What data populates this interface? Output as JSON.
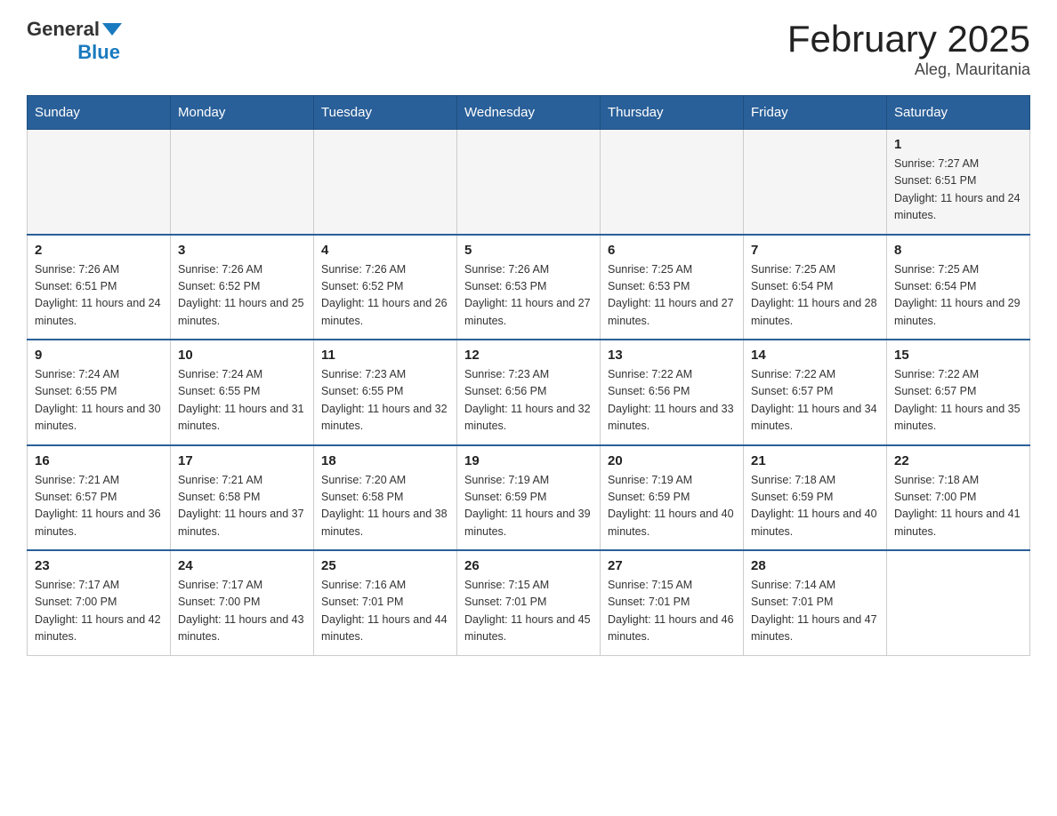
{
  "header": {
    "logo_general": "General",
    "logo_blue": "Blue",
    "title": "February 2025",
    "location": "Aleg, Mauritania"
  },
  "days_of_week": [
    "Sunday",
    "Monday",
    "Tuesday",
    "Wednesday",
    "Thursday",
    "Friday",
    "Saturday"
  ],
  "weeks": [
    [
      {
        "day": "",
        "sunrise": "",
        "sunset": "",
        "daylight": ""
      },
      {
        "day": "",
        "sunrise": "",
        "sunset": "",
        "daylight": ""
      },
      {
        "day": "",
        "sunrise": "",
        "sunset": "",
        "daylight": ""
      },
      {
        "day": "",
        "sunrise": "",
        "sunset": "",
        "daylight": ""
      },
      {
        "day": "",
        "sunrise": "",
        "sunset": "",
        "daylight": ""
      },
      {
        "day": "",
        "sunrise": "",
        "sunset": "",
        "daylight": ""
      },
      {
        "day": "1",
        "sunrise": "Sunrise: 7:27 AM",
        "sunset": "Sunset: 6:51 PM",
        "daylight": "Daylight: 11 hours and 24 minutes."
      }
    ],
    [
      {
        "day": "2",
        "sunrise": "Sunrise: 7:26 AM",
        "sunset": "Sunset: 6:51 PM",
        "daylight": "Daylight: 11 hours and 24 minutes."
      },
      {
        "day": "3",
        "sunrise": "Sunrise: 7:26 AM",
        "sunset": "Sunset: 6:52 PM",
        "daylight": "Daylight: 11 hours and 25 minutes."
      },
      {
        "day": "4",
        "sunrise": "Sunrise: 7:26 AM",
        "sunset": "Sunset: 6:52 PM",
        "daylight": "Daylight: 11 hours and 26 minutes."
      },
      {
        "day": "5",
        "sunrise": "Sunrise: 7:26 AM",
        "sunset": "Sunset: 6:53 PM",
        "daylight": "Daylight: 11 hours and 27 minutes."
      },
      {
        "day": "6",
        "sunrise": "Sunrise: 7:25 AM",
        "sunset": "Sunset: 6:53 PM",
        "daylight": "Daylight: 11 hours and 27 minutes."
      },
      {
        "day": "7",
        "sunrise": "Sunrise: 7:25 AM",
        "sunset": "Sunset: 6:54 PM",
        "daylight": "Daylight: 11 hours and 28 minutes."
      },
      {
        "day": "8",
        "sunrise": "Sunrise: 7:25 AM",
        "sunset": "Sunset: 6:54 PM",
        "daylight": "Daylight: 11 hours and 29 minutes."
      }
    ],
    [
      {
        "day": "9",
        "sunrise": "Sunrise: 7:24 AM",
        "sunset": "Sunset: 6:55 PM",
        "daylight": "Daylight: 11 hours and 30 minutes."
      },
      {
        "day": "10",
        "sunrise": "Sunrise: 7:24 AM",
        "sunset": "Sunset: 6:55 PM",
        "daylight": "Daylight: 11 hours and 31 minutes."
      },
      {
        "day": "11",
        "sunrise": "Sunrise: 7:23 AM",
        "sunset": "Sunset: 6:55 PM",
        "daylight": "Daylight: 11 hours and 32 minutes."
      },
      {
        "day": "12",
        "sunrise": "Sunrise: 7:23 AM",
        "sunset": "Sunset: 6:56 PM",
        "daylight": "Daylight: 11 hours and 32 minutes."
      },
      {
        "day": "13",
        "sunrise": "Sunrise: 7:22 AM",
        "sunset": "Sunset: 6:56 PM",
        "daylight": "Daylight: 11 hours and 33 minutes."
      },
      {
        "day": "14",
        "sunrise": "Sunrise: 7:22 AM",
        "sunset": "Sunset: 6:57 PM",
        "daylight": "Daylight: 11 hours and 34 minutes."
      },
      {
        "day": "15",
        "sunrise": "Sunrise: 7:22 AM",
        "sunset": "Sunset: 6:57 PM",
        "daylight": "Daylight: 11 hours and 35 minutes."
      }
    ],
    [
      {
        "day": "16",
        "sunrise": "Sunrise: 7:21 AM",
        "sunset": "Sunset: 6:57 PM",
        "daylight": "Daylight: 11 hours and 36 minutes."
      },
      {
        "day": "17",
        "sunrise": "Sunrise: 7:21 AM",
        "sunset": "Sunset: 6:58 PM",
        "daylight": "Daylight: 11 hours and 37 minutes."
      },
      {
        "day": "18",
        "sunrise": "Sunrise: 7:20 AM",
        "sunset": "Sunset: 6:58 PM",
        "daylight": "Daylight: 11 hours and 38 minutes."
      },
      {
        "day": "19",
        "sunrise": "Sunrise: 7:19 AM",
        "sunset": "Sunset: 6:59 PM",
        "daylight": "Daylight: 11 hours and 39 minutes."
      },
      {
        "day": "20",
        "sunrise": "Sunrise: 7:19 AM",
        "sunset": "Sunset: 6:59 PM",
        "daylight": "Daylight: 11 hours and 40 minutes."
      },
      {
        "day": "21",
        "sunrise": "Sunrise: 7:18 AM",
        "sunset": "Sunset: 6:59 PM",
        "daylight": "Daylight: 11 hours and 40 minutes."
      },
      {
        "day": "22",
        "sunrise": "Sunrise: 7:18 AM",
        "sunset": "Sunset: 7:00 PM",
        "daylight": "Daylight: 11 hours and 41 minutes."
      }
    ],
    [
      {
        "day": "23",
        "sunrise": "Sunrise: 7:17 AM",
        "sunset": "Sunset: 7:00 PM",
        "daylight": "Daylight: 11 hours and 42 minutes."
      },
      {
        "day": "24",
        "sunrise": "Sunrise: 7:17 AM",
        "sunset": "Sunset: 7:00 PM",
        "daylight": "Daylight: 11 hours and 43 minutes."
      },
      {
        "day": "25",
        "sunrise": "Sunrise: 7:16 AM",
        "sunset": "Sunset: 7:01 PM",
        "daylight": "Daylight: 11 hours and 44 minutes."
      },
      {
        "day": "26",
        "sunrise": "Sunrise: 7:15 AM",
        "sunset": "Sunset: 7:01 PM",
        "daylight": "Daylight: 11 hours and 45 minutes."
      },
      {
        "day": "27",
        "sunrise": "Sunrise: 7:15 AM",
        "sunset": "Sunset: 7:01 PM",
        "daylight": "Daylight: 11 hours and 46 minutes."
      },
      {
        "day": "28",
        "sunrise": "Sunrise: 7:14 AM",
        "sunset": "Sunset: 7:01 PM",
        "daylight": "Daylight: 11 hours and 47 minutes."
      },
      {
        "day": "",
        "sunrise": "",
        "sunset": "",
        "daylight": ""
      }
    ]
  ]
}
